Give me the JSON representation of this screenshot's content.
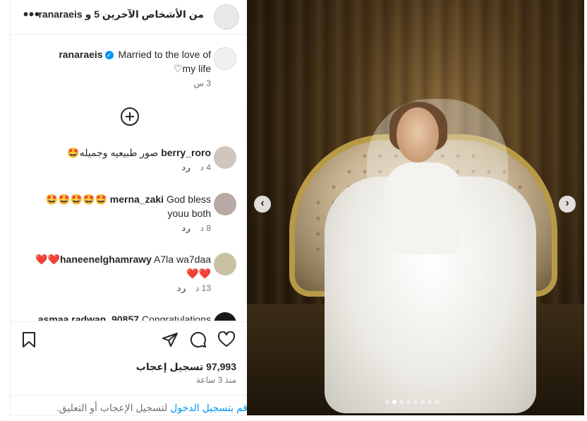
{
  "header": {
    "text": "من الأشخاص الآخرين 5 و ranaraeis",
    "more_label": "•••"
  },
  "caption": {
    "username": "ranaraeis",
    "line1": "Married to the love of",
    "line2": "my life♡",
    "time": "3 س"
  },
  "comments": [
    {
      "username": "berry_roro",
      "text": "صور طبيعيه وجميله🤩",
      "time": "4 د",
      "reply": "رد"
    },
    {
      "username": "merna_zaki",
      "text": "God bless 🤩🤩🤩🤩🤩",
      "text2": "youu both",
      "time": "8 د",
      "reply": "رد"
    },
    {
      "username": "haneenelghamrawy",
      "text": "A7la wa7daa❤️❤️",
      "text2": "❤️❤️",
      "time": "13 د",
      "reply": "رد"
    },
    {
      "username": "asmaa.radwan_90857",
      "text": "Congratulations"
    }
  ],
  "actions": {
    "likes": "97,993 تسجيل إعجاب",
    "time": "منذ 3 ساعة"
  },
  "login": {
    "link": "قم بتسجيل الدخول",
    "text": " لتسجيل الإعجاب أو التعليق."
  },
  "photo": {
    "prev": "‹",
    "next": "›",
    "dots_count": 8,
    "active_dot": 1
  }
}
